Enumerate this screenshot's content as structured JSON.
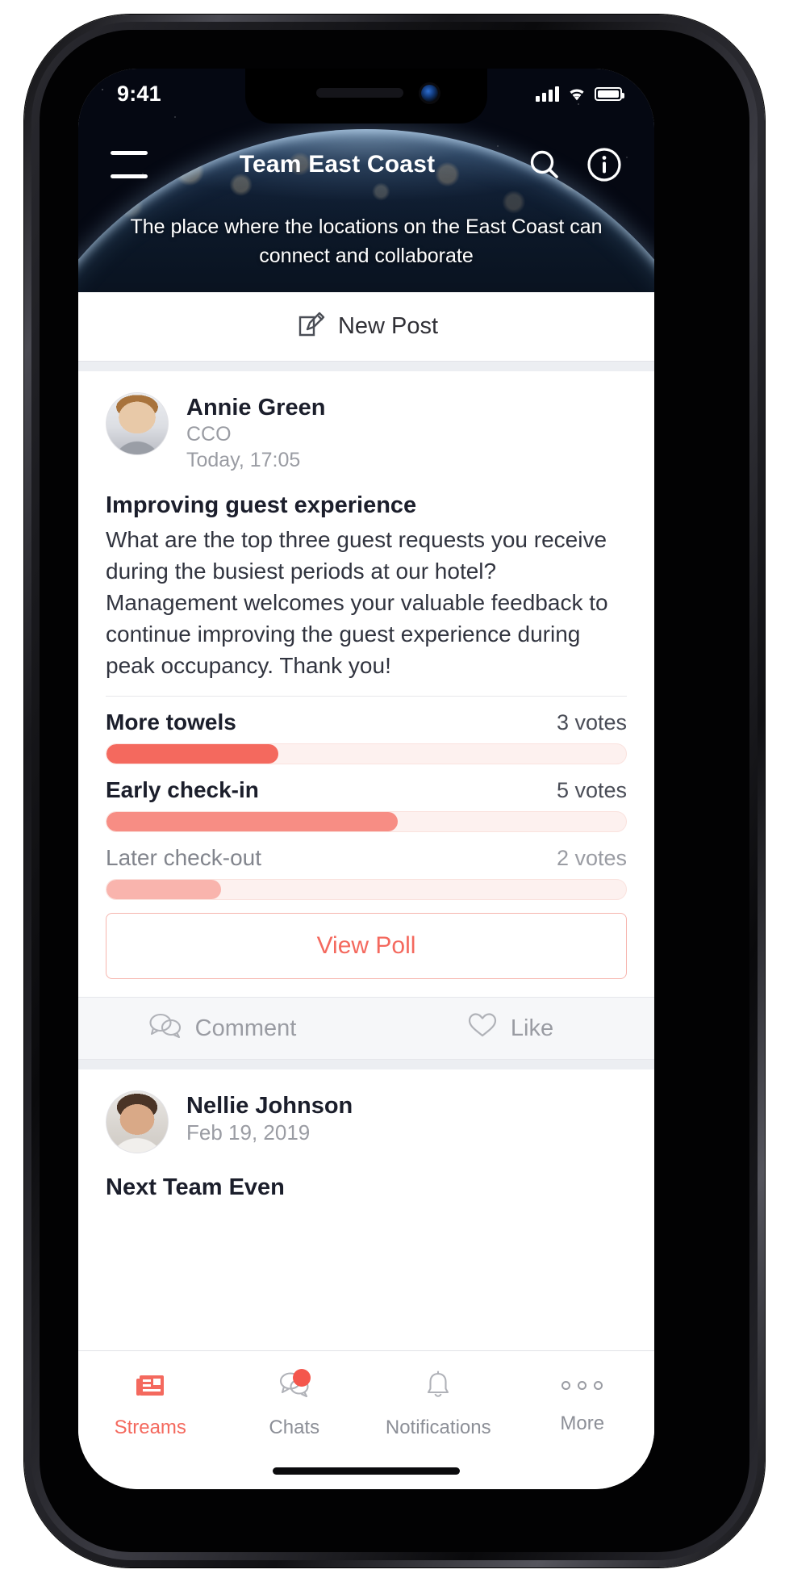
{
  "status_bar": {
    "time": "9:41",
    "signal_icon": "cellular-bars-icon",
    "wifi_icon": "wifi-icon",
    "battery_icon": "battery-full-icon"
  },
  "header": {
    "menu_icon": "hamburger-menu-icon",
    "title": "Team East Coast",
    "search_icon": "search-icon",
    "info_icon": "info-circle-icon",
    "subtitle": "The place where the locations on the East Coast can connect and collaborate"
  },
  "new_post": {
    "label": "New Post",
    "icon": "compose-pencil-square-icon"
  },
  "post": {
    "author": "Annie Green",
    "role": "CCO",
    "time": "Today, 17:05",
    "avatar": "avatar-annie-green",
    "title": "Improving guest experience",
    "body": "What are the top three guest requests you receive during the busiest periods at our hotel? Management welcomes your valuable feedback to continue improving the guest experience during peak occupancy. Thank you!",
    "poll": {
      "options": [
        {
          "label": "More towels",
          "votes": "3 votes",
          "percent": 33,
          "fill_color": "#f4695e",
          "selected": true
        },
        {
          "label": "Early check-in",
          "votes": "5 votes",
          "percent": 56,
          "fill_color": "#f78d84",
          "selected": true
        },
        {
          "label": "Later check-out",
          "votes": "2 votes",
          "percent": 22,
          "fill_color": "#f9b4ad",
          "selected": false
        }
      ],
      "track_color": "#fdf1ef",
      "view_poll_label": "View Poll"
    },
    "actions": [
      {
        "label": "Comment",
        "icon": "comment-bubbles-icon"
      },
      {
        "label": "Like",
        "icon": "heart-icon"
      }
    ]
  },
  "post2": {
    "author": "Nellie Johnson",
    "time": "Feb 19, 2019",
    "avatar": "avatar-nellie-johnson",
    "title": "Next Team Even"
  },
  "tab_bar": {
    "items": [
      {
        "label": "Streams",
        "icon": "newspaper-icon",
        "active": true,
        "badge": false
      },
      {
        "label": "Chats",
        "icon": "chat-bubbles-icon",
        "active": false,
        "badge": true
      },
      {
        "label": "Notifications",
        "icon": "bell-icon",
        "active": false,
        "badge": false
      },
      {
        "label": "More",
        "icon": "three-dots-icon",
        "active": false,
        "badge": false
      }
    ]
  },
  "colors": {
    "accent": "#f4695e",
    "accent_dark": "#f4564c",
    "muted": "#9a9ca3",
    "text": "#1b1e2b"
  }
}
